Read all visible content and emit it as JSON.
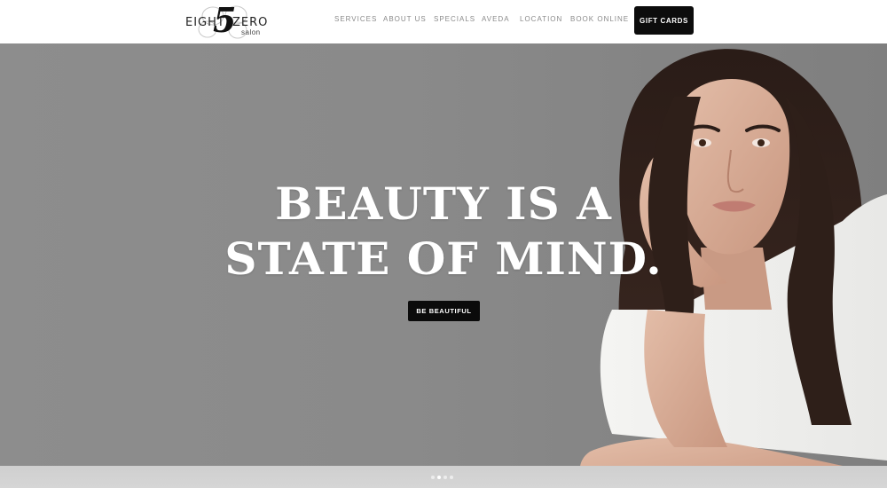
{
  "logo": {
    "word_left": "EIGHT",
    "digit": "5",
    "word_right": "ZERO",
    "sub": "salon"
  },
  "nav": {
    "items": [
      {
        "label": "SERVICES"
      },
      {
        "label": "ABOUT US"
      },
      {
        "label": "SPECIALS"
      },
      {
        "label": "AVEDA"
      },
      {
        "label": "LOCATION"
      },
      {
        "label": "BOOK ONLINE"
      }
    ],
    "gift_cards": "GIFT CARDS"
  },
  "hero": {
    "headline_line1": "BEAUTY IS A",
    "headline_line2": "STATE OF MIND.",
    "cta": "BE BEAUTIFUL",
    "slides": [
      false,
      true,
      false,
      false
    ]
  },
  "colors": {
    "accent": "#0c0c0c",
    "nav_text": "#8a8a8a",
    "hero_bg": "#8a8a8a"
  }
}
